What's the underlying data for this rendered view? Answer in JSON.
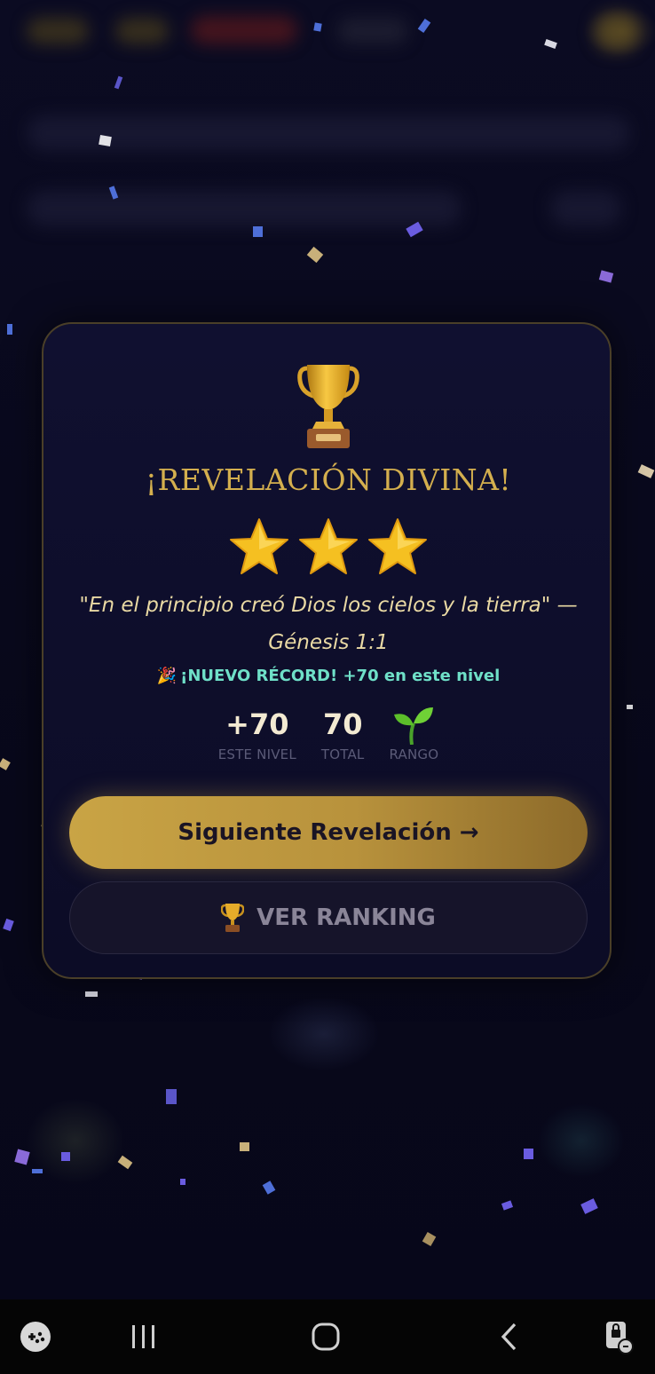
{
  "modal": {
    "title": "¡REVELACIÓN DIVINA!",
    "stars_earned": 3,
    "stars_total": 3,
    "quote": "\"En el principio creó Dios los cielos y la tierra\" — Génesis 1:1",
    "record": {
      "icon": "party-popper-icon",
      "text": "¡NUEVO RÉCORD! +70 en este nivel"
    },
    "stats": [
      {
        "value": "+70",
        "label": "ESTE NIVEL"
      },
      {
        "value": "70",
        "label": "TOTAL"
      },
      {
        "icon": "sprout-icon",
        "label": "RANGO"
      }
    ],
    "next_button": {
      "label": "Siguiente Revelación →"
    },
    "ranking_button": {
      "icon": "trophy-icon",
      "label": "VER RANKING"
    }
  },
  "navbar": {
    "items": [
      "game-launcher-icon",
      "recent-apps-icon",
      "home-icon",
      "back-icon",
      "screen-lock-icon"
    ]
  },
  "colors": {
    "gold": "#d4af4e",
    "quote": "#e9d9a4",
    "record": "#6fe0c8",
    "card_bg": "#101030",
    "screen_bg": "#07071a"
  }
}
